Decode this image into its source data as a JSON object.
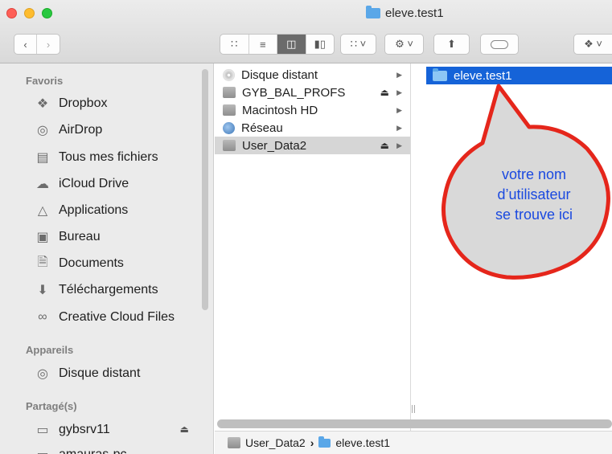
{
  "window": {
    "title": "eleve.test1"
  },
  "toolbar": {
    "share_icon": "share-icon",
    "tag_icon": "tag-icon",
    "dropbox_icon": "dropbox-icon"
  },
  "sidebar": {
    "favoris_header": "Favoris",
    "favoris": [
      {
        "label": "Dropbox",
        "icon": "dropbox-icon"
      },
      {
        "label": "AirDrop",
        "icon": "airdrop-icon"
      },
      {
        "label": "Tous mes fichiers",
        "icon": "all-files-icon"
      },
      {
        "label": "iCloud Drive",
        "icon": "cloud-icon"
      },
      {
        "label": "Applications",
        "icon": "applications-icon"
      },
      {
        "label": "Bureau",
        "icon": "desktop-icon"
      },
      {
        "label": "Documents",
        "icon": "documents-icon"
      },
      {
        "label": "Téléchargements",
        "icon": "downloads-icon"
      },
      {
        "label": "Creative Cloud Files",
        "icon": "creative-cloud-icon"
      }
    ],
    "appareils_header": "Appareils",
    "appareils": [
      {
        "label": "Disque distant",
        "icon": "disc-icon"
      }
    ],
    "partages_header": "Partagé(s)",
    "partages": [
      {
        "label": "gybsrv11",
        "icon": "display-icon"
      },
      {
        "label": "amauras-pc",
        "icon": "display-icon"
      }
    ]
  },
  "column1": {
    "items": [
      {
        "label": "Disque distant",
        "icon": "disc-icon"
      },
      {
        "label": "GYB_BAL_PROFS",
        "icon": "drive-icon"
      },
      {
        "label": "Macintosh HD",
        "icon": "drive-icon"
      },
      {
        "label": "Réseau",
        "icon": "network-icon"
      },
      {
        "label": "User_Data2",
        "icon": "drive-icon"
      }
    ],
    "selected": "User_Data2"
  },
  "column2": {
    "items": [
      {
        "label": "eleve.test1",
        "icon": "folder-icon"
      }
    ]
  },
  "pathbar": {
    "items": [
      "User_Data2",
      "eleve.test1"
    ],
    "separator": "›"
  },
  "callout": {
    "lines": [
      "votre nom",
      "d’utilisateur",
      "se trouve ici"
    ],
    "border_color": "#e5261b",
    "fill_color": "#d9d9d9",
    "text_color": "#1a49e0"
  }
}
